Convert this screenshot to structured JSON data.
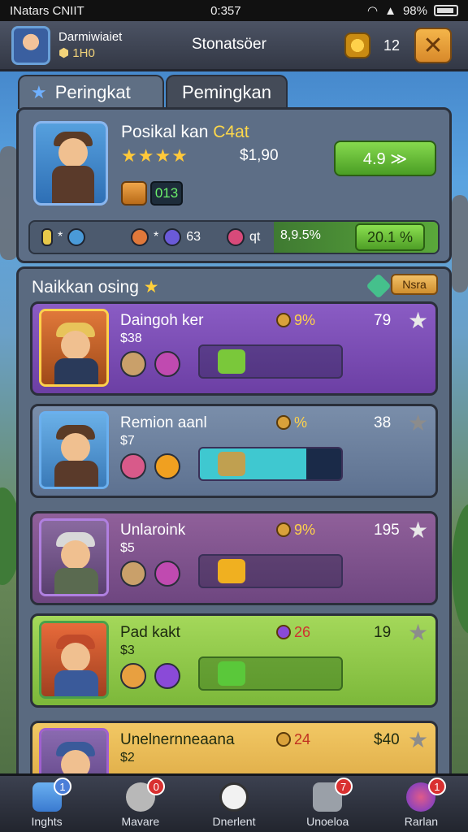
{
  "status": {
    "carrier": "INatars CNIIT",
    "time": "0:357",
    "battery": "98%"
  },
  "topbar": {
    "player_name": "Darmiwiaiet",
    "player_level": "1H0",
    "title": "Stonatsöer",
    "coins": "12"
  },
  "tabs": [
    "Peringkat",
    "Pemingkan"
  ],
  "rank": {
    "name": "Posikal kan",
    "name_accent": "C4at",
    "stars": "★★★★",
    "score": "$1,90",
    "button": "4.9 ≫",
    "level": "013",
    "stats": [
      "*",
      "*",
      "63",
      "qt",
      "8,9.5%"
    ],
    "total": "20.1 %"
  },
  "list": {
    "title": "Naikkan osing",
    "more": "Nsra",
    "rows": [
      {
        "name": "Daingoh ker",
        "price": "$38",
        "stat": "9%",
        "count": "79",
        "theme": "purple",
        "progress": 0
      },
      {
        "name": "Remion aanl",
        "price": "$7",
        "stat": "%",
        "count": "38",
        "theme": "blue",
        "progress": 0.75
      },
      {
        "name": "Unlaroink",
        "price": "$5",
        "stat": "9%",
        "count": "195",
        "theme": "violet",
        "progress": 0
      },
      {
        "name": "Pad kakt",
        "price": "$3",
        "stat": "26",
        "count": "19",
        "theme": "lime",
        "progress": 0
      },
      {
        "name": "Unelnernneaana",
        "price": "$2",
        "stat": "24",
        "count": "$40",
        "theme": "gold",
        "progress": 0
      }
    ]
  },
  "nav": [
    {
      "label": "Inghts",
      "badge": "1",
      "icon": "home-icon"
    },
    {
      "label": "Mavare",
      "badge": "0",
      "icon": "face-icon"
    },
    {
      "label": "Dnerlent",
      "badge": "",
      "icon": "battle-icon"
    },
    {
      "label": "Unoeloa",
      "badge": "7",
      "icon": "team-icon"
    },
    {
      "label": "Rarlan",
      "badge": "1",
      "icon": "rank-icon"
    }
  ],
  "colors": {
    "accent_green": "#5aa83a",
    "accent_gold": "#ffd24a"
  }
}
